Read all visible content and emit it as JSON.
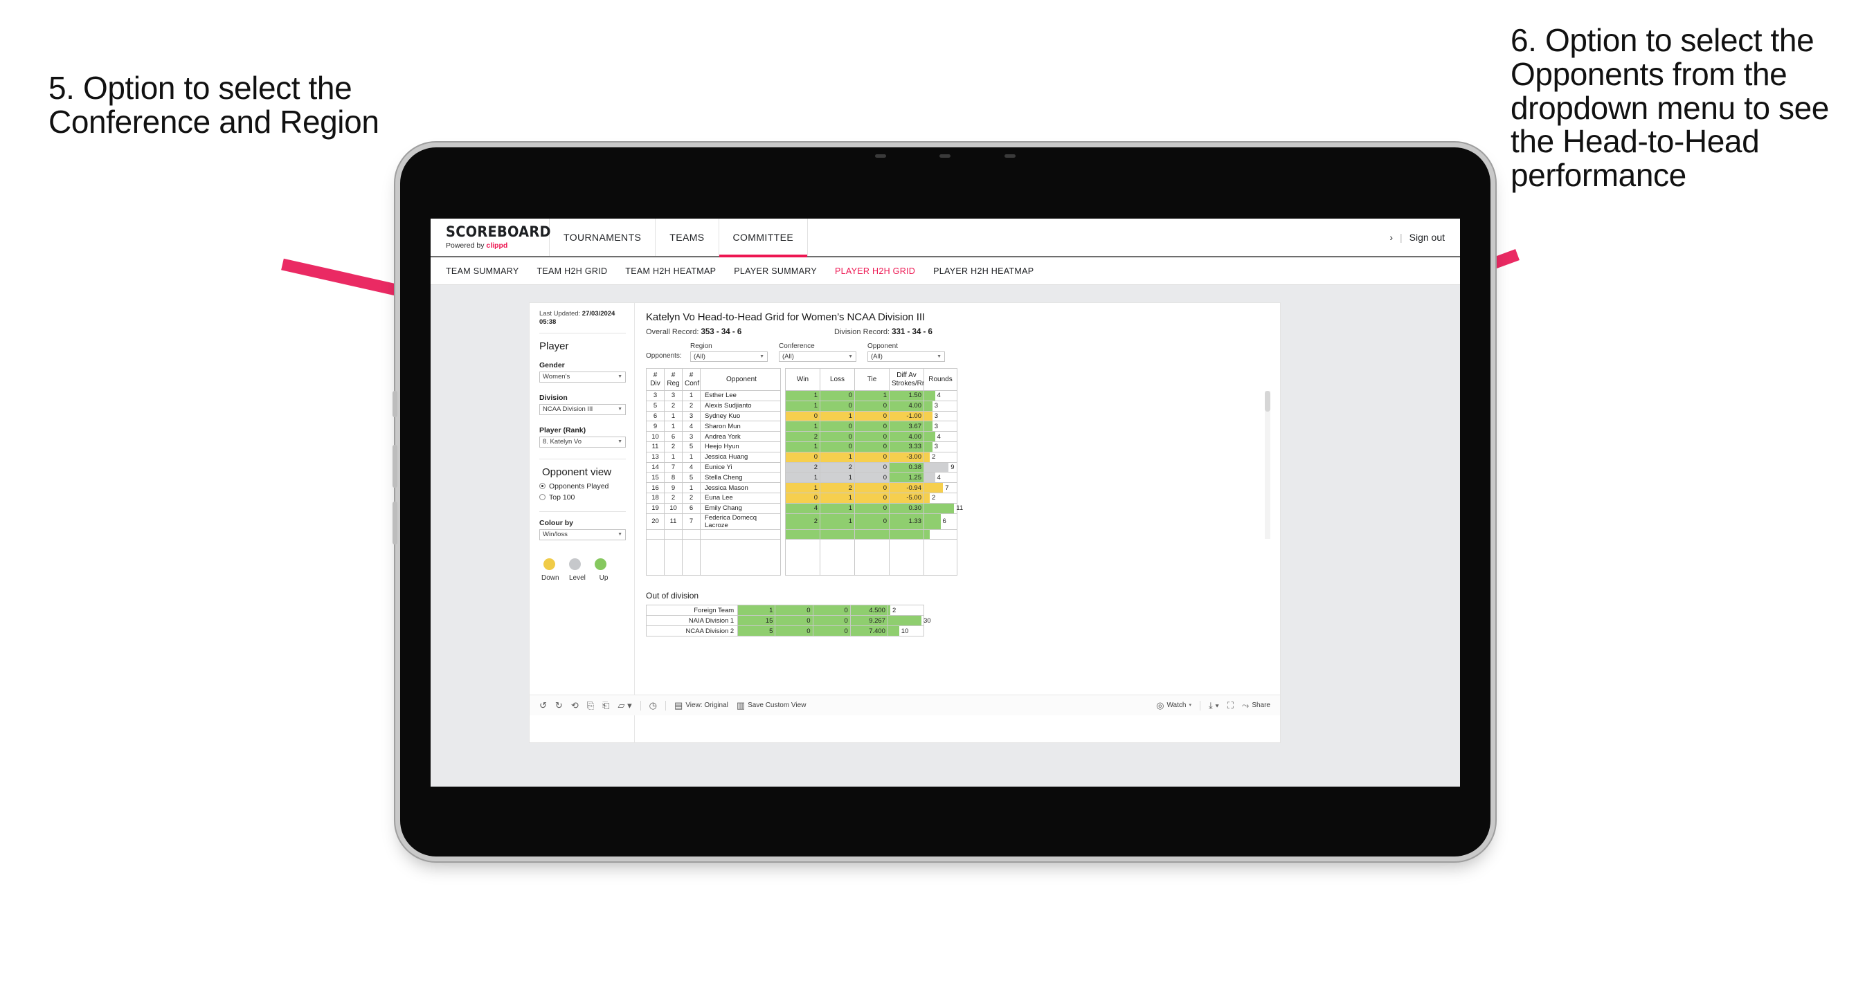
{
  "annotations": {
    "left": "5. Option to select the Conference and Region",
    "right": "6. Option to select the Opponents from the dropdown menu to see the Head-to-Head performance",
    "arrow_color": "#ea2a63"
  },
  "appbar": {
    "brand_title": "SCOREBOARD",
    "brand_sub_prefix": "Powered by ",
    "brand_sub_name": "clippd",
    "nav": [
      {
        "label": "TOURNAMENTS",
        "active": false
      },
      {
        "label": "TEAMS",
        "active": false
      },
      {
        "label": "COMMITTEE",
        "active": true
      }
    ],
    "chevron": "›",
    "separator": "|",
    "signout": "Sign out"
  },
  "subnav": [
    {
      "label": "TEAM SUMMARY",
      "active": false
    },
    {
      "label": "TEAM H2H GRID",
      "active": false
    },
    {
      "label": "TEAM H2H HEATMAP",
      "active": false
    },
    {
      "label": "PLAYER SUMMARY",
      "active": false
    },
    {
      "label": "PLAYER H2H GRID",
      "active": true
    },
    {
      "label": "PLAYER H2H HEATMAP",
      "active": false
    }
  ],
  "sidebar": {
    "last_updated_label": "Last Updated: ",
    "last_updated_value": "27/03/2024",
    "last_updated_time": "05:38",
    "player_section": "Player",
    "fields": [
      {
        "label": "Gender",
        "value": "Women’s"
      },
      {
        "label": "Division",
        "value": "NCAA Division III"
      },
      {
        "label": "Player (Rank)",
        "value": "8. Katelyn Vo"
      }
    ],
    "opponent_view_title": "Opponent view",
    "opponent_view_options": [
      {
        "label": "Opponents Played",
        "selected": true
      },
      {
        "label": "Top 100",
        "selected": false
      }
    ],
    "colour_by_label": "Colour by",
    "colour_by_value": "Win/loss",
    "legend": [
      {
        "label": "Down",
        "color": "#f0cb47"
      },
      {
        "label": "Level",
        "color": "#c6c8cb"
      },
      {
        "label": "Up",
        "color": "#86c85f"
      }
    ]
  },
  "main": {
    "title": "Katelyn Vo Head-to-Head Grid for Women’s NCAA Division III",
    "overall_record_label": "Overall Record: ",
    "overall_record_value": "353 - 34 - 6",
    "division_record_label": "Division Record: ",
    "division_record_value": "331 - 34 - 6",
    "opponents_label": "Opponents:",
    "filters": [
      {
        "label": "Region",
        "value": "(All)"
      },
      {
        "label": "Conference",
        "value": "(All)"
      },
      {
        "label": "Opponent",
        "value": "(All)"
      }
    ]
  },
  "chart_data": {
    "type": "table",
    "title": "Katelyn Vo Head-to-Head Grid for Women’s NCAA Division III",
    "columns": [
      "# Div",
      "# Reg",
      "# Conf",
      "Opponent",
      "Win",
      "Loss",
      "Tie",
      "Diff Av Strokes/Rnd",
      "Rounds"
    ],
    "header_lines": [
      [
        "#",
        "Div"
      ],
      [
        "#",
        "Reg"
      ],
      [
        "#",
        "Conf"
      ],
      [
        "Opponent"
      ],
      [
        "Win"
      ],
      [
        "Loss"
      ],
      [
        "Tie"
      ],
      [
        "Diff Av",
        "Strokes/Rnd"
      ],
      [
        "Rounds"
      ]
    ],
    "rounds_max": 12,
    "rows": [
      {
        "div": "3",
        "reg": "3",
        "conf": "1",
        "opponent": "Esther Lee",
        "win": "1",
        "loss": "0",
        "tie": "1",
        "diff": "1.50",
        "rounds": 4,
        "state": "up"
      },
      {
        "div": "5",
        "reg": "2",
        "conf": "2",
        "opponent": "Alexis Sudjianto",
        "win": "1",
        "loss": "0",
        "tie": "0",
        "diff": "4.00",
        "rounds": 3,
        "state": "up"
      },
      {
        "div": "6",
        "reg": "1",
        "conf": "3",
        "opponent": "Sydney Kuo",
        "win": "0",
        "loss": "1",
        "tie": "0",
        "diff": "-1.00",
        "rounds": 3,
        "state": "down"
      },
      {
        "div": "9",
        "reg": "1",
        "conf": "4",
        "opponent": "Sharon Mun",
        "win": "1",
        "loss": "0",
        "tie": "0",
        "diff": "3.67",
        "rounds": 3,
        "state": "up"
      },
      {
        "div": "10",
        "reg": "6",
        "conf": "3",
        "opponent": "Andrea York",
        "win": "2",
        "loss": "0",
        "tie": "0",
        "diff": "4.00",
        "rounds": 4,
        "state": "up"
      },
      {
        "div": "11",
        "reg": "2",
        "conf": "5",
        "opponent": "Heejo Hyun",
        "win": "1",
        "loss": "0",
        "tie": "0",
        "diff": "3.33",
        "rounds": 3,
        "state": "up"
      },
      {
        "div": "13",
        "reg": "1",
        "conf": "1",
        "opponent": "Jessica Huang",
        "win": "0",
        "loss": "1",
        "tie": "0",
        "diff": "-3.00",
        "rounds": 2,
        "state": "down"
      },
      {
        "div": "14",
        "reg": "7",
        "conf": "4",
        "opponent": "Eunice Yi",
        "win": "2",
        "loss": "2",
        "tie": "0",
        "diff": "0.38",
        "rounds": 9,
        "state": "level",
        "diff_state": "up"
      },
      {
        "div": "15",
        "reg": "8",
        "conf": "5",
        "opponent": "Stella Cheng",
        "win": "1",
        "loss": "1",
        "tie": "0",
        "diff": "1.25",
        "rounds": 4,
        "state": "level",
        "diff_state": "up"
      },
      {
        "div": "16",
        "reg": "9",
        "conf": "1",
        "opponent": "Jessica Mason",
        "win": "1",
        "loss": "2",
        "tie": "0",
        "diff": "-0.94",
        "rounds": 7,
        "state": "down"
      },
      {
        "div": "18",
        "reg": "2",
        "conf": "2",
        "opponent": "Euna Lee",
        "win": "0",
        "loss": "1",
        "tie": "0",
        "diff": "-5.00",
        "rounds": 2,
        "state": "down"
      },
      {
        "div": "19",
        "reg": "10",
        "conf": "6",
        "opponent": "Emily Chang",
        "win": "4",
        "loss": "1",
        "tie": "0",
        "diff": "0.30",
        "rounds": 11,
        "state": "up"
      },
      {
        "div": "20",
        "reg": "11",
        "conf": "7",
        "opponent": "Federica Domecq Lacroze",
        "win": "2",
        "loss": "1",
        "tie": "0",
        "diff": "1.33",
        "rounds": 6,
        "state": "up"
      }
    ],
    "out_of_division_title": "Out of division",
    "out_of_division": [
      {
        "name": "Foreign Team",
        "win": "1",
        "loss": "0",
        "tie": "0",
        "diff": "4.500",
        "rounds": 2,
        "state": "up"
      },
      {
        "name": "NAIA Division 1",
        "win": "15",
        "loss": "0",
        "tie": "0",
        "diff": "9.267",
        "rounds": 30,
        "state": "up"
      },
      {
        "name": "NCAA Division 2",
        "win": "5",
        "loss": "0",
        "tie": "0",
        "diff": "7.400",
        "rounds": 10,
        "state": "up"
      }
    ],
    "ood_rounds_max": 32
  },
  "toolbar": {
    "view_label": "View: Original",
    "save_label": "Save Custom View",
    "watch_label": "Watch",
    "share_label": "Share"
  }
}
